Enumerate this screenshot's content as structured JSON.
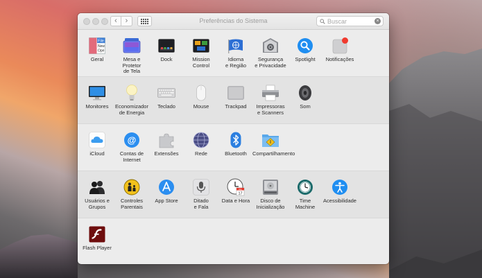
{
  "window": {
    "title": "Preferências do Sistema",
    "search_placeholder": "Buscar",
    "nav_back": "‹",
    "nav_forward": "›",
    "clear_symbol": "×"
  },
  "sections": [
    {
      "items": [
        {
          "label": "Geral",
          "icon": "general-icon"
        },
        {
          "label": "Mesa e Protetor\nde Tela",
          "icon": "desktop-screensaver-icon"
        },
        {
          "label": "Dock",
          "icon": "dock-icon"
        },
        {
          "label": "Mission\nControl",
          "icon": "mission-control-icon"
        },
        {
          "label": "Idioma\ne Região",
          "icon": "language-region-icon"
        },
        {
          "label": "Segurança\ne Privacidade",
          "icon": "security-privacy-icon"
        },
        {
          "label": "Spotlight",
          "icon": "spotlight-icon"
        },
        {
          "label": "Notificações",
          "icon": "notifications-icon"
        }
      ]
    },
    {
      "items": [
        {
          "label": "Monitores",
          "icon": "displays-icon"
        },
        {
          "label": "Economizador\nde Energia",
          "icon": "energy-saver-icon"
        },
        {
          "label": "Teclado",
          "icon": "keyboard-icon"
        },
        {
          "label": "Mouse",
          "icon": "mouse-icon"
        },
        {
          "label": "Trackpad",
          "icon": "trackpad-icon"
        },
        {
          "label": "Impressoras\ne Scanners",
          "icon": "printers-scanners-icon"
        },
        {
          "label": "Som",
          "icon": "sound-icon"
        }
      ]
    },
    {
      "items": [
        {
          "label": "iCloud",
          "icon": "icloud-icon"
        },
        {
          "label": "Contas de\nInternet",
          "icon": "internet-accounts-icon"
        },
        {
          "label": "Extensões",
          "icon": "extensions-icon"
        },
        {
          "label": "Rede",
          "icon": "network-icon"
        },
        {
          "label": "Bluetooth",
          "icon": "bluetooth-icon"
        },
        {
          "label": "Compartilhamento",
          "icon": "sharing-icon"
        }
      ]
    },
    {
      "items": [
        {
          "label": "Usuários e\nGrupos",
          "icon": "users-groups-icon"
        },
        {
          "label": "Controles\nParentais",
          "icon": "parental-controls-icon"
        },
        {
          "label": "App Store",
          "icon": "app-store-icon"
        },
        {
          "label": "Ditado\ne Fala",
          "icon": "dictation-speech-icon"
        },
        {
          "label": "Data e Hora",
          "icon": "date-time-icon"
        },
        {
          "label": "Disco de\nInicialização",
          "icon": "startup-disk-icon"
        },
        {
          "label": "Time\nMachine",
          "icon": "time-machine-icon"
        },
        {
          "label": "Acessibilidade",
          "icon": "accessibility-icon"
        }
      ]
    },
    {
      "items": [
        {
          "label": "Flash Player",
          "icon": "flash-player-icon"
        }
      ]
    }
  ],
  "icon_glyphs": {
    "general_file": "File",
    "general_new": "New",
    "general_ope": "Ope",
    "calendar_day": "17",
    "calendar_month": "JUL"
  },
  "colors": {
    "window_bg": "#ececec",
    "alt_row": "#e3e3e3",
    "notification_dot": "#f03a2e",
    "accent_blue": "#1f8ef1"
  }
}
